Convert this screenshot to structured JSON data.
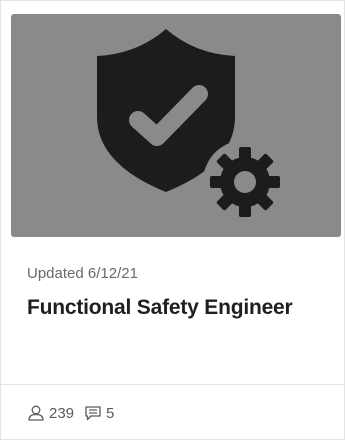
{
  "card": {
    "thumbnail_icon": "shield-check-gear-icon",
    "updated_text": "Updated 6/12/21",
    "title": "Functional Safety Engineer",
    "stats": {
      "members_icon": "user-icon",
      "members_count": "239",
      "comments_icon": "comment-icon",
      "comments_count": "5"
    }
  },
  "colors": {
    "thumbnail_bg": "#8a8a8a",
    "icon_fill": "#1b1c1e",
    "title": "#1f1f1f",
    "meta": "#6a6a6a"
  }
}
